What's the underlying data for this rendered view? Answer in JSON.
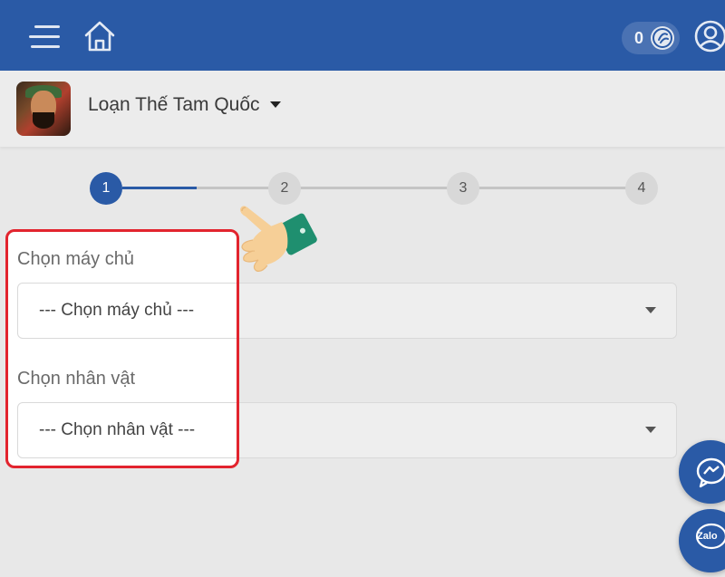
{
  "header": {
    "coin_count": "0"
  },
  "game": {
    "name": "Loạn Thế Tam Quốc"
  },
  "stepper": {
    "steps": [
      "1",
      "2",
      "3",
      "4"
    ],
    "active": 1
  },
  "form": {
    "server": {
      "label": "Chọn máy chủ",
      "placeholder": "--- Chọn máy chủ ---"
    },
    "character": {
      "label": "Chọn nhân vật",
      "placeholder": "--- Chọn nhân vật ---"
    }
  },
  "floating": {
    "zalo_label": "Zalo"
  },
  "colors": {
    "brand": "#2a5aa6",
    "highlight": "#e2242e"
  }
}
